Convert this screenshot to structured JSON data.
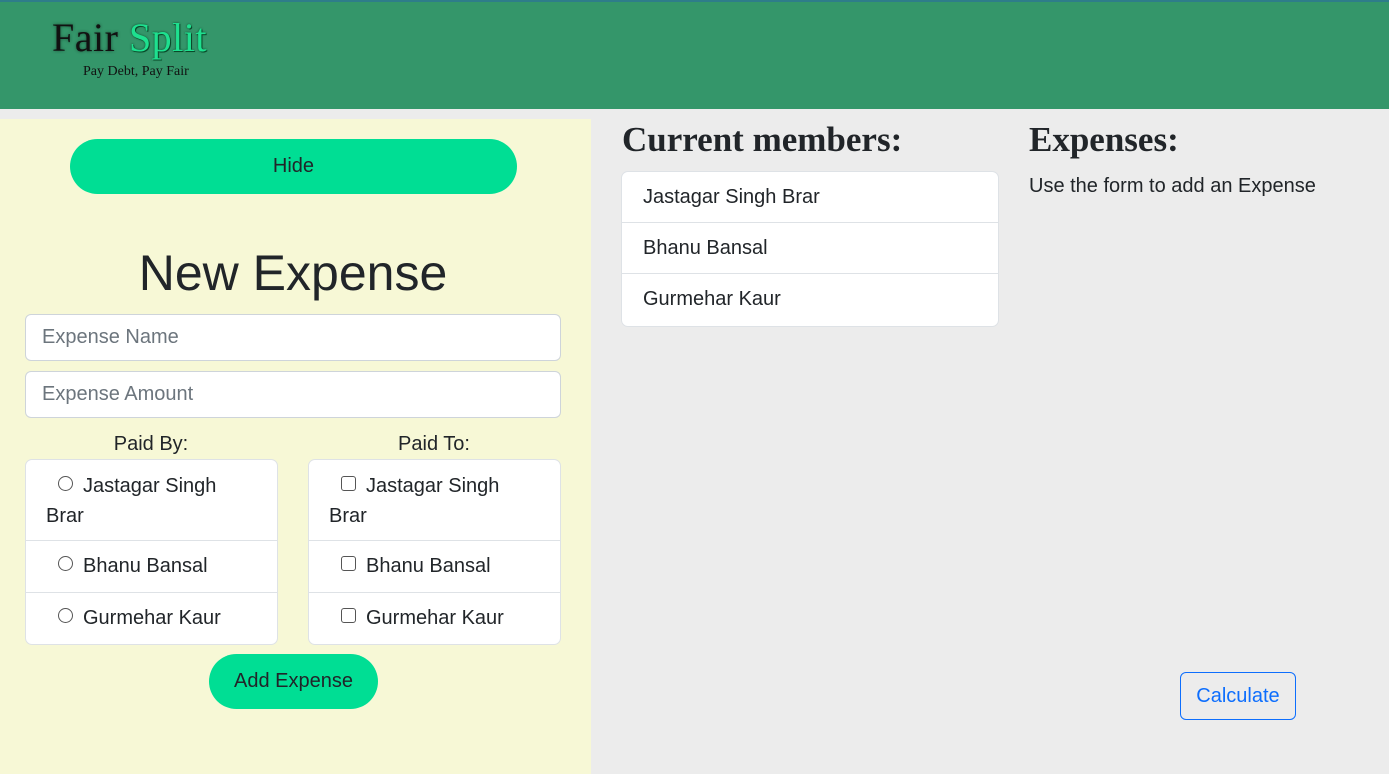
{
  "brand": {
    "word1": "Fair",
    "word2": "Split",
    "tagline": "Pay Debt, Pay Fair"
  },
  "colors": {
    "navbar": "#34966a",
    "left_panel": "#f7f8d6",
    "page_bg": "#ececec",
    "accent_button": "#00de94",
    "calculate_button": "#0d6efd"
  },
  "sidebar": {
    "hide_label": "Hide"
  },
  "form": {
    "title": "New Expense",
    "name_placeholder": "Expense Name",
    "name_value": "",
    "amount_placeholder": "Expense Amount",
    "amount_value": "",
    "paid_by_label": "Paid By:",
    "paid_to_label": "Paid To:",
    "paid_by": [
      {
        "name": "Jastagar Singh Brar",
        "selected": false
      },
      {
        "name": "Bhanu Bansal",
        "selected": false
      },
      {
        "name": "Gurmehar Kaur",
        "selected": false
      }
    ],
    "paid_to": [
      {
        "name": "Jastagar Singh Brar",
        "checked": false
      },
      {
        "name": "Bhanu Bansal",
        "checked": false
      },
      {
        "name": "Gurmehar Kaur",
        "checked": false
      }
    ],
    "add_label": "Add Expense"
  },
  "members": {
    "title": "Current members:",
    "items": [
      "Jastagar Singh Brar",
      "Bhanu Bansal",
      "Gurmehar Kaur"
    ]
  },
  "expenses": {
    "title": "Expenses:",
    "hint": "Use the form to add an Expense",
    "calculate_label": "Calculate"
  }
}
